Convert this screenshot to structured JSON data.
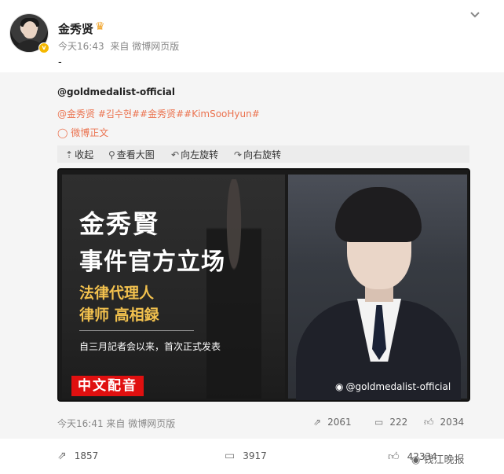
{
  "author": {
    "name": "金秀贤",
    "verified_badge": "v",
    "crown_icon": "crown-icon",
    "time": "今天16:43",
    "source": "来自 微博网页版",
    "text": "-"
  },
  "repost": {
    "handle": "@goldmedalist-official",
    "tags": "@金秀贤 #김수현##金秀贤##KimSooHyun#",
    "original_link": "微博正文",
    "toolbar": {
      "collapse": "收起",
      "view_large": "查看大图",
      "rotate_left": "向左旋转",
      "rotate_right": "向右旋转"
    },
    "image": {
      "title_line1": "金秀賢",
      "title_line2": "事件官方立场",
      "sub_line1": "法律代理人",
      "sub_line2": "律师 高相録",
      "caption": "自三月記者会以来，首次正式发表",
      "badge": "中文配音",
      "watermark": "@goldmedalist-official"
    },
    "footer": {
      "time": "今天16:41",
      "source": "来自 微博网页版",
      "reposts": "2061",
      "comments": "222",
      "likes": "2034"
    }
  },
  "footer": {
    "reposts": "1857",
    "comments": "3917",
    "likes": "42334",
    "credit": "钱江晚报"
  },
  "colors": {
    "accent": "#eb7350",
    "badge_red": "#e01010",
    "subtitle_gold": "#f2c14e"
  }
}
